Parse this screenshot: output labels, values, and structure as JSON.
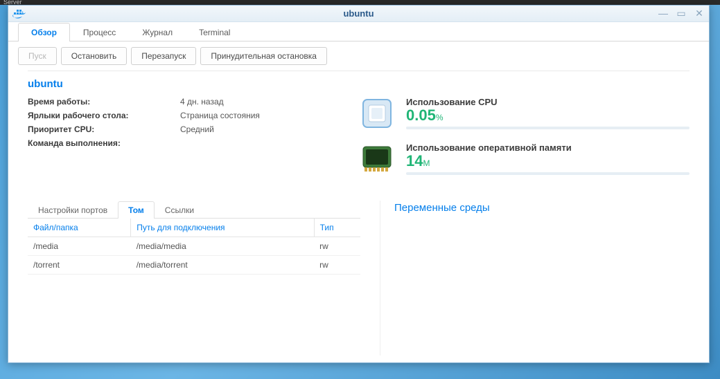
{
  "taskbar_text": "Server",
  "window": {
    "title": "ubuntu",
    "tabs": [
      {
        "label": "Обзор",
        "active": true
      },
      {
        "label": "Процесс",
        "active": false
      },
      {
        "label": "Журнал",
        "active": false
      },
      {
        "label": "Terminal",
        "active": false
      }
    ],
    "actions": [
      {
        "label": "Пуск",
        "disabled": true
      },
      {
        "label": "Остановить",
        "disabled": false
      },
      {
        "label": "Перезапуск",
        "disabled": false
      },
      {
        "label": "Принудительная остановка",
        "disabled": false
      }
    ],
    "container_name": "ubuntu",
    "details": [
      {
        "label": "Время работы:",
        "value": "4 дн. назад"
      },
      {
        "label": "Ярлыки рабочего стола:",
        "value": "Страница состояния"
      },
      {
        "label": "Приоритет CPU:",
        "value": "Средний"
      },
      {
        "label": "Команда выполнения:",
        "value": ""
      }
    ],
    "metrics": {
      "cpu": {
        "title": "Использование CPU",
        "value": "0.05",
        "unit": "%"
      },
      "memory": {
        "title": "Использование оперативной памяти",
        "value": "14",
        "unit": "M"
      }
    },
    "sub_tabs": [
      {
        "label": "Настройки портов",
        "active": false
      },
      {
        "label": "Том",
        "active": true
      },
      {
        "label": "Ссылки",
        "active": false
      }
    ],
    "volumes": {
      "headers": {
        "file": "Файл/папка",
        "mount": "Путь для подключения",
        "type": "Тип"
      },
      "rows": [
        {
          "file": "/media",
          "mount": "/media/media",
          "type": "rw"
        },
        {
          "file": "/torrent",
          "mount": "/media/torrent",
          "type": "rw"
        }
      ]
    },
    "env_title": "Переменные среды"
  }
}
